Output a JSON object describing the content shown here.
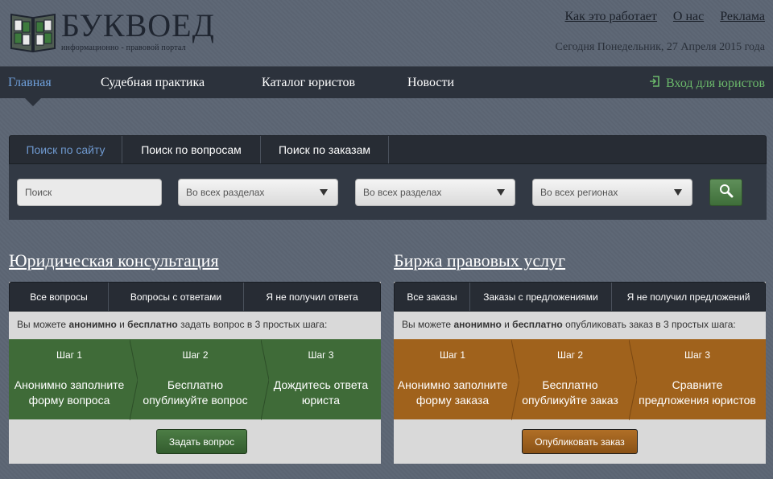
{
  "brand": {
    "title": "БУКВОЕД",
    "subtitle": "информационно - правовой портал"
  },
  "top_links": [
    "Как это работает",
    "О нас",
    "Реклама"
  ],
  "date_text": "Сегодня Понедельник, 27 Апреля 2015 года",
  "nav": {
    "items": [
      "Главная",
      "Судебная практика",
      "Каталог юристов",
      "Новости"
    ],
    "login": "Вход для юристов"
  },
  "search": {
    "tabs": [
      "Поиск по сайту",
      "Поиск по вопросам",
      "Поиск по заказам"
    ],
    "placeholder": "Поиск",
    "select1": "Во всех разделах",
    "select2": "Во всех разделах",
    "select3": "Во всех регионах"
  },
  "consult": {
    "title": "Юридическая консультация",
    "tabs": [
      "Все вопросы",
      "Вопросы с ответами",
      "Я не получил ответа"
    ],
    "info_pre": "Вы можете ",
    "info_b1": "анонимно",
    "info_mid": " и ",
    "info_b2": "бесплатно",
    "info_post": " задать вопрос в 3 простых шага:",
    "steps": [
      {
        "label": "Шаг 1",
        "desc1": "Анонимно заполните",
        "desc2": "форму вопроса"
      },
      {
        "label": "Шаг 2",
        "desc1": "Бесплатно",
        "desc2": "опубликуйте вопрос"
      },
      {
        "label": "Шаг 3",
        "desc1": "Дождитесь ответа",
        "desc2": "юриста"
      }
    ],
    "button": "Задать вопрос"
  },
  "exchange": {
    "title": "Биржа правовых услуг",
    "tabs": [
      "Все заказы",
      "Заказы с предложениями",
      "Я не получил предложений"
    ],
    "info_pre": "Вы можете ",
    "info_b1": "анонимно",
    "info_mid": " и ",
    "info_b2": "бесплатно",
    "info_post": " опубликовать заказ в 3 простых шага:",
    "steps": [
      {
        "label": "Шаг 1",
        "desc1": "Анонимно заполните",
        "desc2": "форму заказа"
      },
      {
        "label": "Шаг 2",
        "desc1": "Бесплатно",
        "desc2": "опубликуйте заказ"
      },
      {
        "label": "Шаг 3",
        "desc1": "Сравните",
        "desc2": "предложения юристов"
      }
    ],
    "button": "Опубликовать заказ"
  },
  "colors": {
    "background": "#5c6674",
    "nav": "#2c323c",
    "accent_blue": "#6fa0db",
    "green": "#3f6b38",
    "orange": "#a0621c",
    "login_green": "#6bb86b"
  },
  "icons": [
    "book-logo-icon",
    "login-icon",
    "search-icon",
    "chevron-down-icon"
  ]
}
